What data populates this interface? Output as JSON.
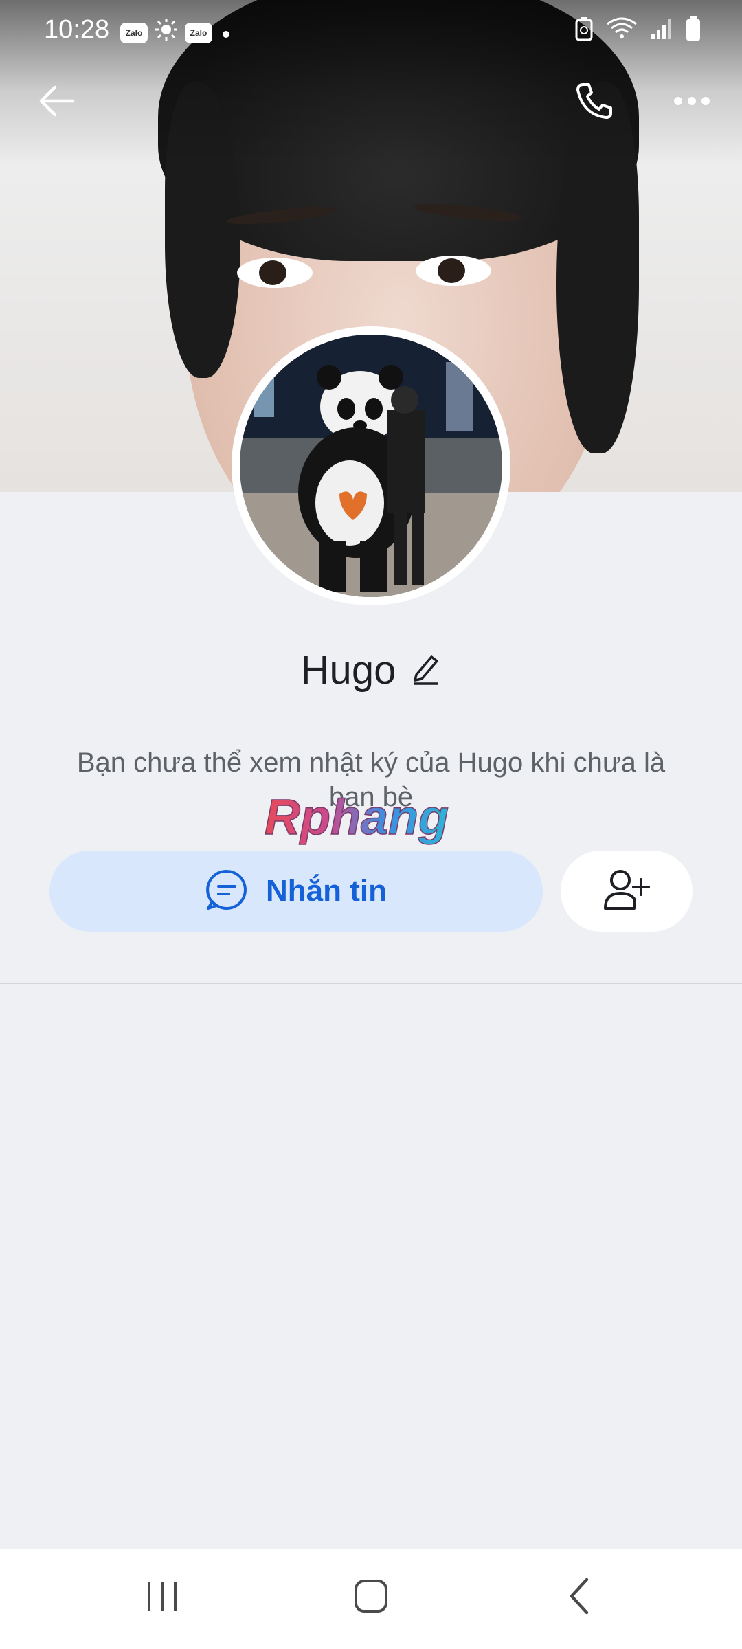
{
  "status_bar": {
    "time": "10:28",
    "left_icons": [
      "zalo-icon",
      "brightness-icon",
      "zalo-icon",
      "dot-icon"
    ],
    "right_icons": [
      "battery-saver-icon",
      "wifi-icon",
      "signal-icon",
      "battery-icon"
    ],
    "zalo_text": "Zalo"
  },
  "top_bar": {
    "icons": [
      "back-arrow-icon",
      "phone-icon",
      "more-icon"
    ]
  },
  "profile": {
    "name": "Hugo",
    "edit_icon": "pencil-icon",
    "description": "Bạn chưa thể xem nhật ký của Hugo khi chưa là bạn bè",
    "watermark_text": "Rphang"
  },
  "actions": {
    "message_label": "Nhắn tin",
    "message_icon": "chat-bubble-icon",
    "add_friend_icon": "add-person-icon"
  },
  "system_nav": {
    "icons": [
      "recent-apps-icon",
      "home-icon",
      "back-icon"
    ]
  },
  "colors": {
    "accent": "#1561d8",
    "button_bg": "#d8e7fb",
    "page_bg": "#eff0f4"
  }
}
